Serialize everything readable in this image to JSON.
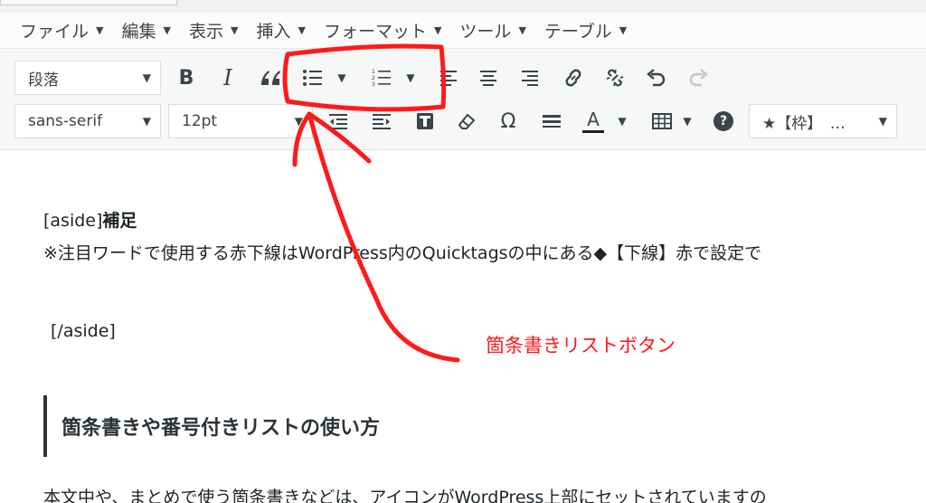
{
  "menubar": {
    "items": [
      {
        "label": "ファイル"
      },
      {
        "label": "編集"
      },
      {
        "label": "表示"
      },
      {
        "label": "挿入"
      },
      {
        "label": "フォーマット"
      },
      {
        "label": "ツール"
      },
      {
        "label": "テーブル"
      }
    ]
  },
  "toolbar": {
    "format_select": "段落",
    "font_family_select": "sans-serif",
    "font_size_select": "12pt",
    "bold_label": "B",
    "italic_label": "I",
    "special_char_label": "Ω",
    "text_color_label": "A",
    "help_label": "?",
    "style_select": "★【枠】　…",
    "text_color_underline": "#1e1e1e"
  },
  "content": {
    "aside_open": "[aside]",
    "aside_title": "補足",
    "note": "※注目ワードで使用する赤下線はWordPress内のQuicktagsの中にある◆【下線】赤で設定で",
    "aside_close": "[/aside]",
    "heading": "箇条書きや番号付きリストの使い方",
    "body": "本文中や、まとめで使う箇条書きなどは、アイコンがWordPress上部にセットされていますの"
  },
  "annotation": {
    "label": "箇条書きリストボタン",
    "color": "#ff1a1a"
  }
}
